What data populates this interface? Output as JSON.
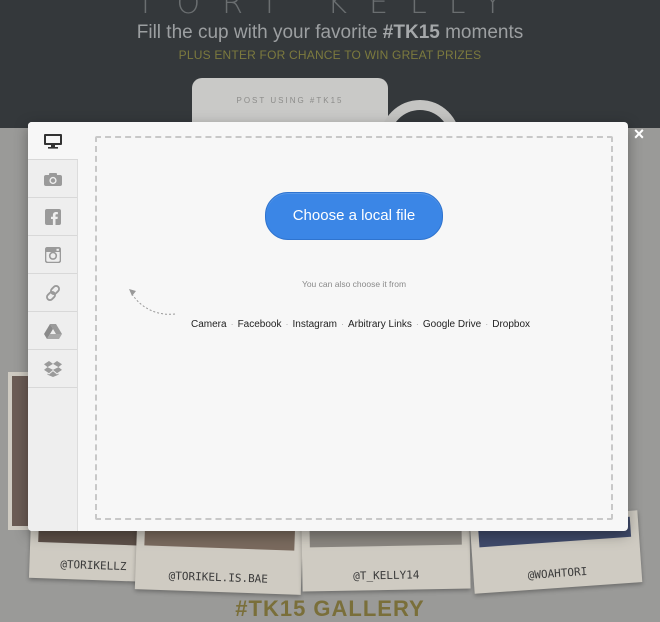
{
  "background": {
    "logo": "TORI KELLY",
    "headline_prefix": "Fill the cup with your favorite ",
    "headline_tag": "#TK15",
    "headline_suffix": " moments",
    "subheadline": "PLUS ENTER FOR CHANCE TO WIN GREAT PRIZES",
    "cup_text": "POST USING #TK15",
    "polaroids": [
      {
        "handle": "@TORIKELLZ"
      },
      {
        "handle": "@TORIKEL.IS.BAE"
      },
      {
        "handle": "@T_KELLY14"
      },
      {
        "handle": "@WOAHTORI"
      }
    ],
    "gallery_heading": "#TK15 GALLERY"
  },
  "modal": {
    "close_label": "×",
    "tabs": [
      {
        "name": "computer",
        "icon": "monitor-icon",
        "active": true
      },
      {
        "name": "camera",
        "icon": "camera-icon",
        "active": false
      },
      {
        "name": "facebook",
        "icon": "facebook-icon",
        "active": false
      },
      {
        "name": "instagram",
        "icon": "instagram-icon",
        "active": false
      },
      {
        "name": "link",
        "icon": "link-icon",
        "active": false
      },
      {
        "name": "google-drive",
        "icon": "google-drive-icon",
        "active": false
      },
      {
        "name": "dropbox",
        "icon": "dropbox-icon",
        "active": false
      }
    ],
    "choose_button": "Choose a local file",
    "also_text": "You can also choose it from",
    "sources": [
      "Camera",
      "Facebook",
      "Instagram",
      "Arbitrary Links",
      "Google Drive",
      "Dropbox"
    ],
    "separator": "·"
  },
  "colors": {
    "accent": "#3b86e6",
    "overlay": "#9a9a98",
    "header_bg": "#34383b"
  }
}
